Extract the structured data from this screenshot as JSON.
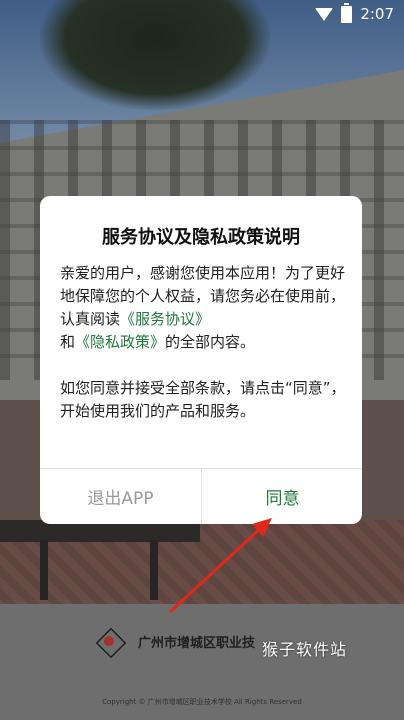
{
  "status_bar": {
    "time": "2:07",
    "icons": [
      "wifi-icon",
      "battery-icon"
    ]
  },
  "dialog": {
    "title": "服务协议及隐私政策说明",
    "para1_before": "亲爱的用户，感谢您使用本应用！为了更好地保障您的个人权益，请您务必在使用前，认真阅读",
    "service_link": "《服务协议》",
    "para1_middle": "和",
    "privacy_link": "《隐私政策》",
    "para1_after": "的全部内容。",
    "para2": "如您同意并接受全部条款，请点击“同意”，开始使用我们的产品和服务。",
    "exit_label": "退出APP",
    "agree_label": "同意"
  },
  "footer": {
    "school_name": "广州市增城区职业技",
    "copyright": "Copyright © 广州市增城区职业技术学校 All Rights Reserved",
    "watermark": "猴子软件站"
  },
  "colors": {
    "accent": "#1e7a3a",
    "exit_text": "#9a9a9a",
    "annotation_arrow": "#e0281c"
  }
}
